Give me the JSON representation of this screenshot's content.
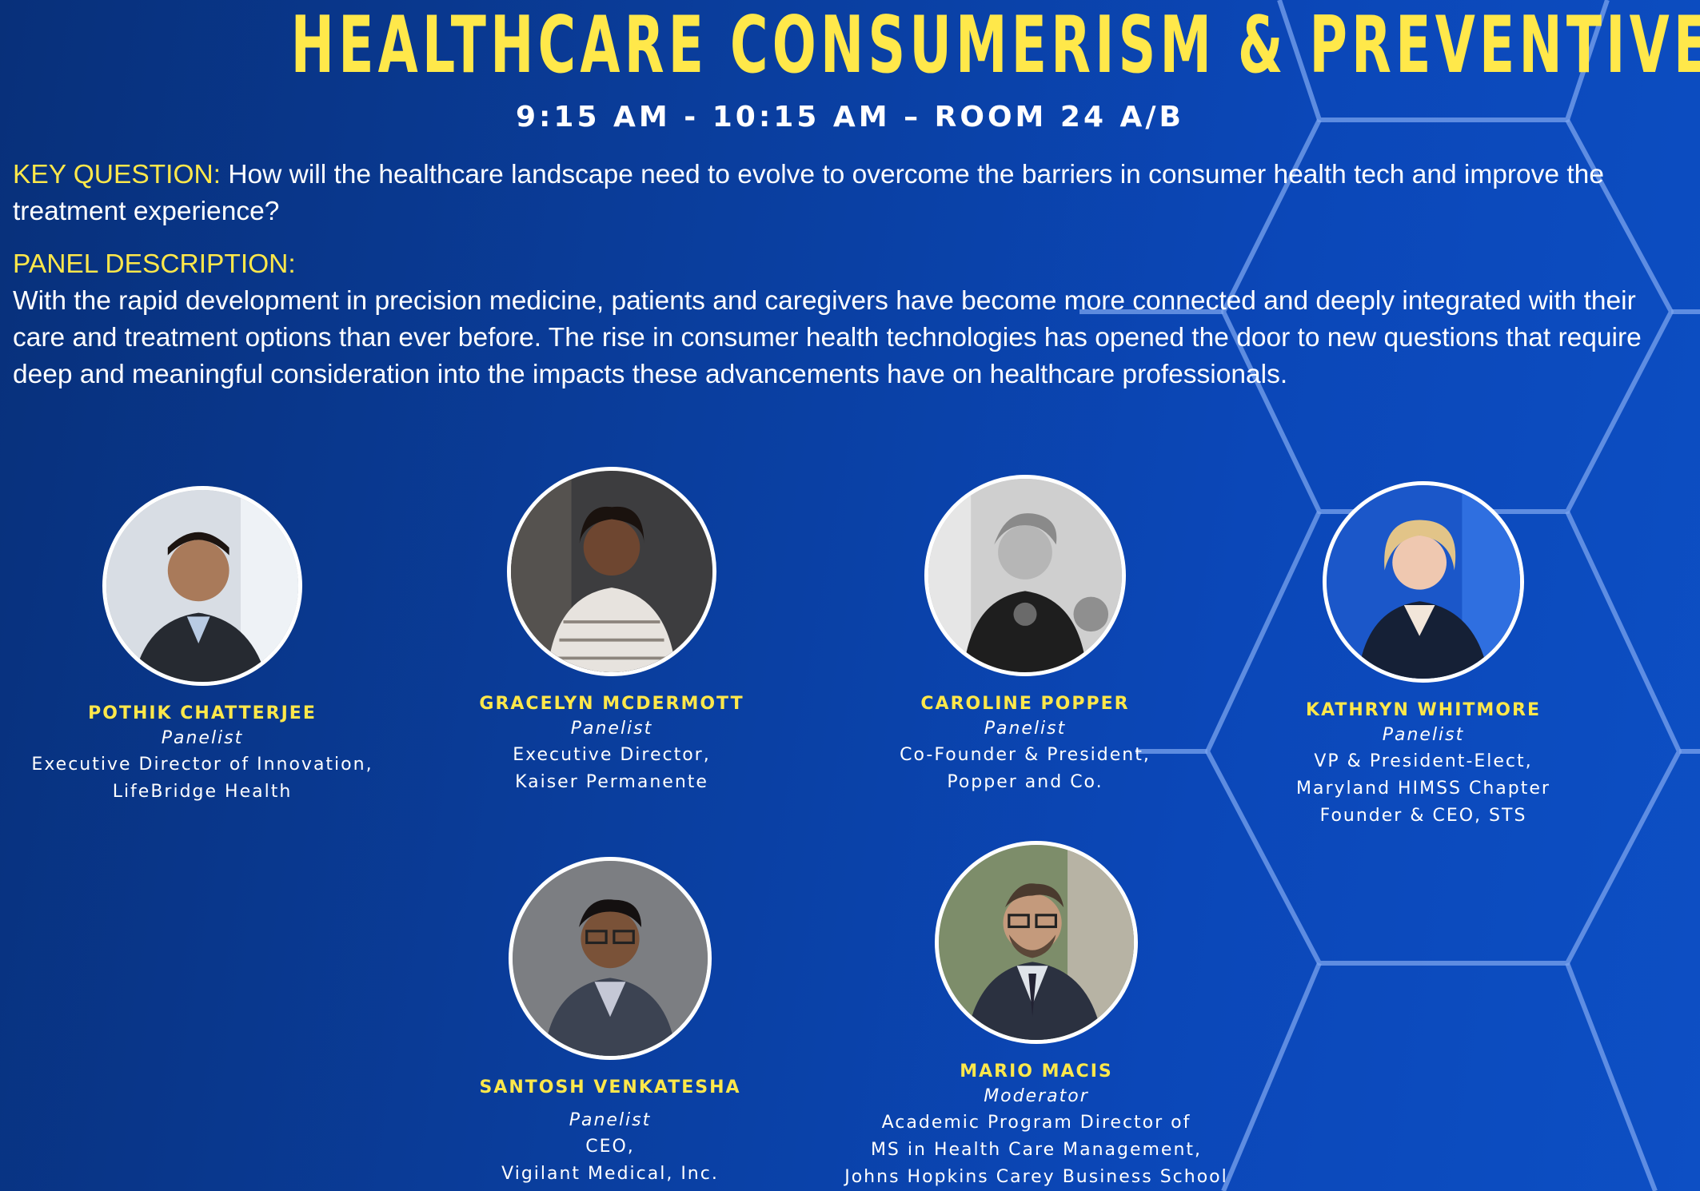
{
  "header": {
    "title": "HEALTHCARE CONSUMERISM & PREVENTIVE CARE",
    "session": "9:15 AM - 10:15 AM – ROOM 24 A/B"
  },
  "key_question": {
    "label": "KEY QUESTION:",
    "text": " How will the healthcare landscape need to evolve to overcome the barriers in consumer health tech and improve the treatment experience?"
  },
  "panel_description": {
    "label": "PANEL DESCRIPTION:",
    "text": "With the rapid development in precision medicine, patients and caregivers have become more connected and deeply integrated with their care and treatment options than ever before. The rise in consumer health technologies has opened the door to new questions that require deep and meaningful consideration into the impacts these advancements have on healthcare professionals."
  },
  "speakers": [
    {
      "name": "POTHIK CHATTERJEE",
      "role": "Panelist",
      "lines": [
        "Executive Director of Innovation,",
        "LifeBridge Health"
      ]
    },
    {
      "name": "GRACELYN MCDERMOTT",
      "role": "Panelist",
      "lines": [
        "Executive Director,",
        "Kaiser Permanente"
      ]
    },
    {
      "name": "CAROLINE POPPER",
      "role": "Panelist",
      "lines": [
        "Co-Founder & President,",
        "Popper and Co."
      ]
    },
    {
      "name": "KATHRYN WHITMORE",
      "role": "Panelist",
      "lines": [
        "VP & President-Elect,",
        "Maryland HIMSS Chapter",
        "Founder & CEO, STS"
      ]
    },
    {
      "name": "SANTOSH VENKATESHA",
      "role": "Panelist",
      "lines": [
        "CEO,",
        "Vigilant Medical, Inc."
      ]
    },
    {
      "name": "MARIO MACIS",
      "role": "Moderator",
      "lines": [
        "Academic Program Director of",
        "MS in Health Care Management,",
        "Johns Hopkins Carey Business School"
      ]
    }
  ],
  "colors": {
    "accent_yellow": "#ffe84a",
    "background_blue": "#0a3e9e",
    "hex_line": "#6f9be8"
  }
}
